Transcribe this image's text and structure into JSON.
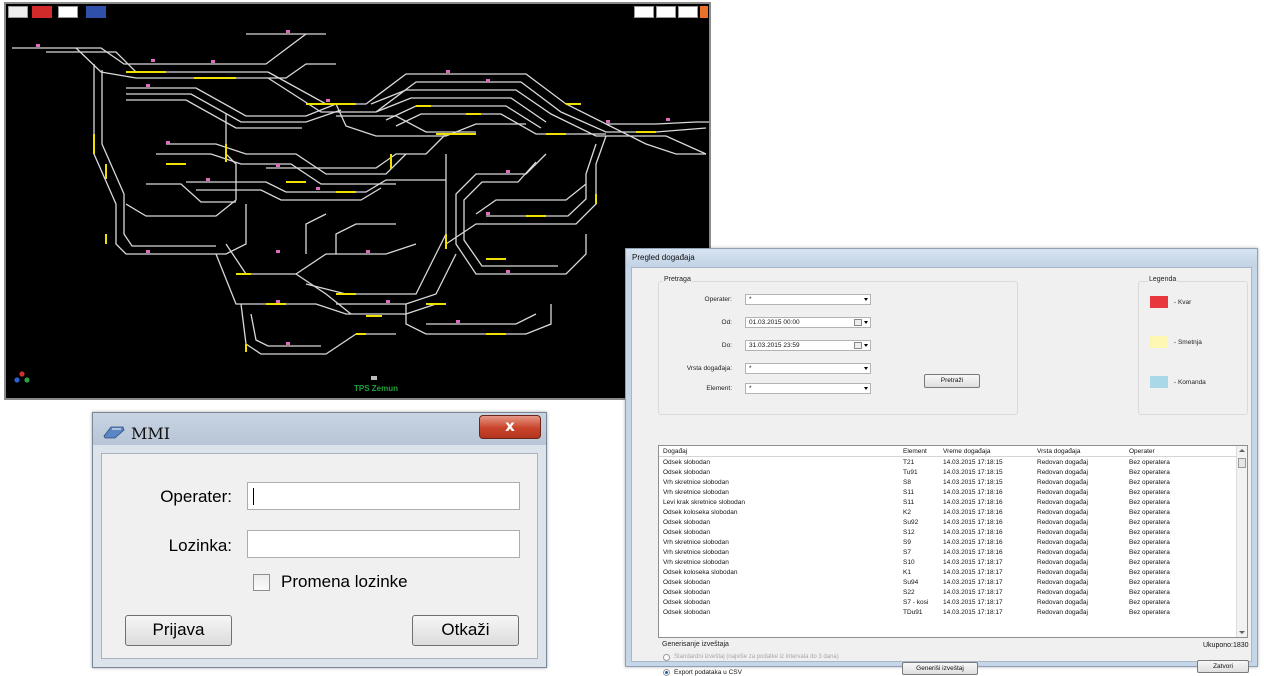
{
  "diagram": {
    "station_name": "TPS Zemun",
    "colors": {
      "background": "#000000",
      "track": "#d9d9d9",
      "occupied": "#f0e000",
      "signal": "#e06cc0"
    }
  },
  "login_dialog": {
    "title": "MMI",
    "close_label": "x",
    "operator_label": "Operater:",
    "operator_value": "",
    "password_label": "Lozinka:",
    "password_value": "",
    "change_password_label": "Promena lozinke",
    "change_password_checked": false,
    "login_button": "Prijava",
    "cancel_button": "Otkaži"
  },
  "events_dialog": {
    "title": "Pregled događaja",
    "search": {
      "group_title": "Pretraga",
      "operator_label": "Operater:",
      "operator_value": "*",
      "from_label": "Od:",
      "from_value": "01.03.2015 00:00",
      "to_label": "Do:",
      "to_value": "31.03.2015 23:59",
      "event_type_label": "Vrsta događaja:",
      "event_type_value": "*",
      "element_label": "Element:",
      "element_value": "*",
      "search_button": "Pretraži"
    },
    "legend": {
      "title": "Legenda",
      "items": [
        {
          "label": "- Kvar",
          "color": "#e8383d"
        },
        {
          "label": "- Smetnja",
          "color": "#fdf7b3"
        },
        {
          "label": "- Komanda",
          "color": "#a9d8e8"
        }
      ]
    },
    "table": {
      "columns": [
        "Događaj",
        "Element",
        "Vreme događaja",
        "Vrsta događaja",
        "Operater"
      ],
      "rows": [
        [
          "Odsek slobodan",
          "T21",
          "14.03.2015 17:18:15",
          "Redovan događaj",
          "Bez operatera"
        ],
        [
          "Odsek slobodan",
          "Tu91",
          "14.03.2015 17:18:15",
          "Redovan događaj",
          "Bez operatera"
        ],
        [
          "Vrh skretnice slobodan",
          "S8",
          "14.03.2015 17:18:15",
          "Redovan događaj",
          "Bez operatera"
        ],
        [
          "Vrh skretnice slobodan",
          "S11",
          "14.03.2015 17:18:16",
          "Redovan događaj",
          "Bez operatera"
        ],
        [
          "Levi krak skretnice slobodan",
          "S11",
          "14.03.2015 17:18:16",
          "Redovan događaj",
          "Bez operatera"
        ],
        [
          "Odsek koloseka slobodan",
          "K2",
          "14.03.2015 17:18:16",
          "Redovan događaj",
          "Bez operatera"
        ],
        [
          "Odsek slobodan",
          "Su92",
          "14.03.2015 17:18:16",
          "Redovan događaj",
          "Bez operatera"
        ],
        [
          "Odsek slobodan",
          "S12",
          "14.03.2015 17:18:16",
          "Redovan događaj",
          "Bez operatera"
        ],
        [
          "Vrh skretnice slobodan",
          "S9",
          "14.03.2015 17:18:16",
          "Redovan događaj",
          "Bez operatera"
        ],
        [
          "Vrh skretnice slobodan",
          "S7",
          "14.03.2015 17:18:16",
          "Redovan događaj",
          "Bez operatera"
        ],
        [
          "Vrh skretnice slobodan",
          "S10",
          "14.03.2015 17:18:17",
          "Redovan događaj",
          "Bez operatera"
        ],
        [
          "Odsek koloseka slobodan",
          "K1",
          "14.03.2015 17:18:17",
          "Redovan događaj",
          "Bez operatera"
        ],
        [
          "Odsek slobodan",
          "Su94",
          "14.03.2015 17:18:17",
          "Redovan događaj",
          "Bez operatera"
        ],
        [
          "Odsek slobodan",
          "S22",
          "14.03.2015 17:18:17",
          "Redovan događaj",
          "Bez operatera"
        ],
        [
          "Odsek slobodan",
          "S7 - kosi",
          "14.03.2015 17:18:17",
          "Redovan događaj",
          "Bez operatera"
        ],
        [
          "Odsek slobodan",
          "TDu91",
          "14.03.2015 17:18:17",
          "Redovan događaj",
          "Bez operatera"
        ]
      ]
    },
    "total_label": "Ukupono:1830",
    "report": {
      "group_title": "Generisanje izveštaja",
      "option_standard": "Standardni izveštaj (najviše za podatke iz intervala do 3 dana)",
      "option_csv": "Export podataka u CSV",
      "selected": "csv",
      "generate_button": "Generiši izveštaj"
    },
    "close_button": "Zatvori"
  }
}
